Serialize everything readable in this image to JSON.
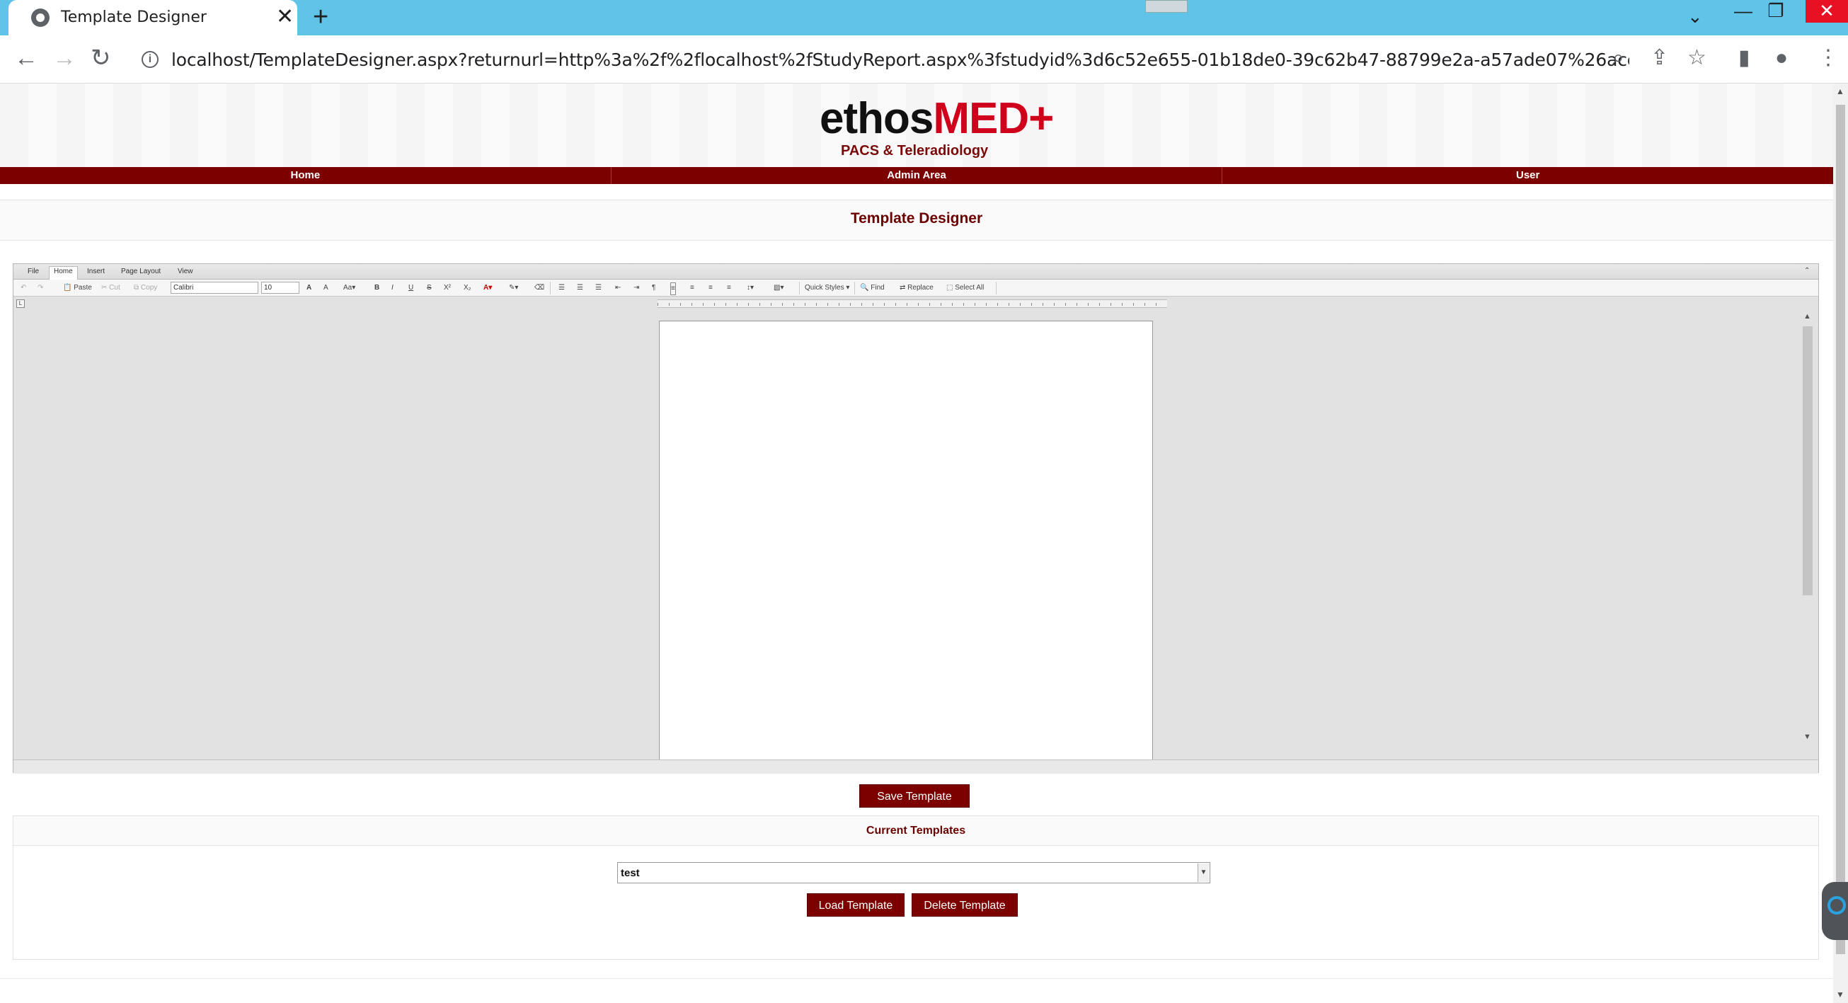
{
  "browser": {
    "tab_title": "Template Designer",
    "tab_close": "✕",
    "new_tab": "+",
    "tab_search": "⌄",
    "url": "localhost/TemplateDesigner.aspx?returnurl=http%3a%2f%2flocalhost%2fStudyReport.aspx%3fstudyid%3d6c52e655-01b18de0-39c62b47-88799e2a-a57ade07%26accession%3d%26pid%3d1...",
    "back": "←",
    "forward": "→",
    "reload": "↻",
    "minimize": "—",
    "restore": "❐",
    "close": "✕"
  },
  "header": {
    "logo_prefix": "ethos",
    "logo_suffix": "MED+",
    "subtitle": "PACS & Teleradiology"
  },
  "menu": {
    "items": [
      "Home",
      "Admin Area",
      "User"
    ]
  },
  "page": {
    "title": "Template Designer"
  },
  "editor": {
    "ribbon_tabs": [
      "File",
      "Home",
      "Insert",
      "Page Layout",
      "View"
    ],
    "active_tab": "Home",
    "paste": "Paste",
    "cut": "Cut",
    "copy": "Copy",
    "font_name": "Calibri",
    "font_size": "10",
    "quick_styles": "Quick Styles ▾",
    "find": "Find",
    "replace": "Replace",
    "select_all": "Select All",
    "ruler_corner": "L"
  },
  "actions": {
    "save": "Save Template",
    "load": "Load Template",
    "delete": "Delete Template"
  },
  "templates": {
    "heading": "Current Templates",
    "selected": "test"
  },
  "colors": {
    "brand": "#7d0000",
    "logo_accent": "#d0021b",
    "tab_bar": "#5fc4e8"
  }
}
